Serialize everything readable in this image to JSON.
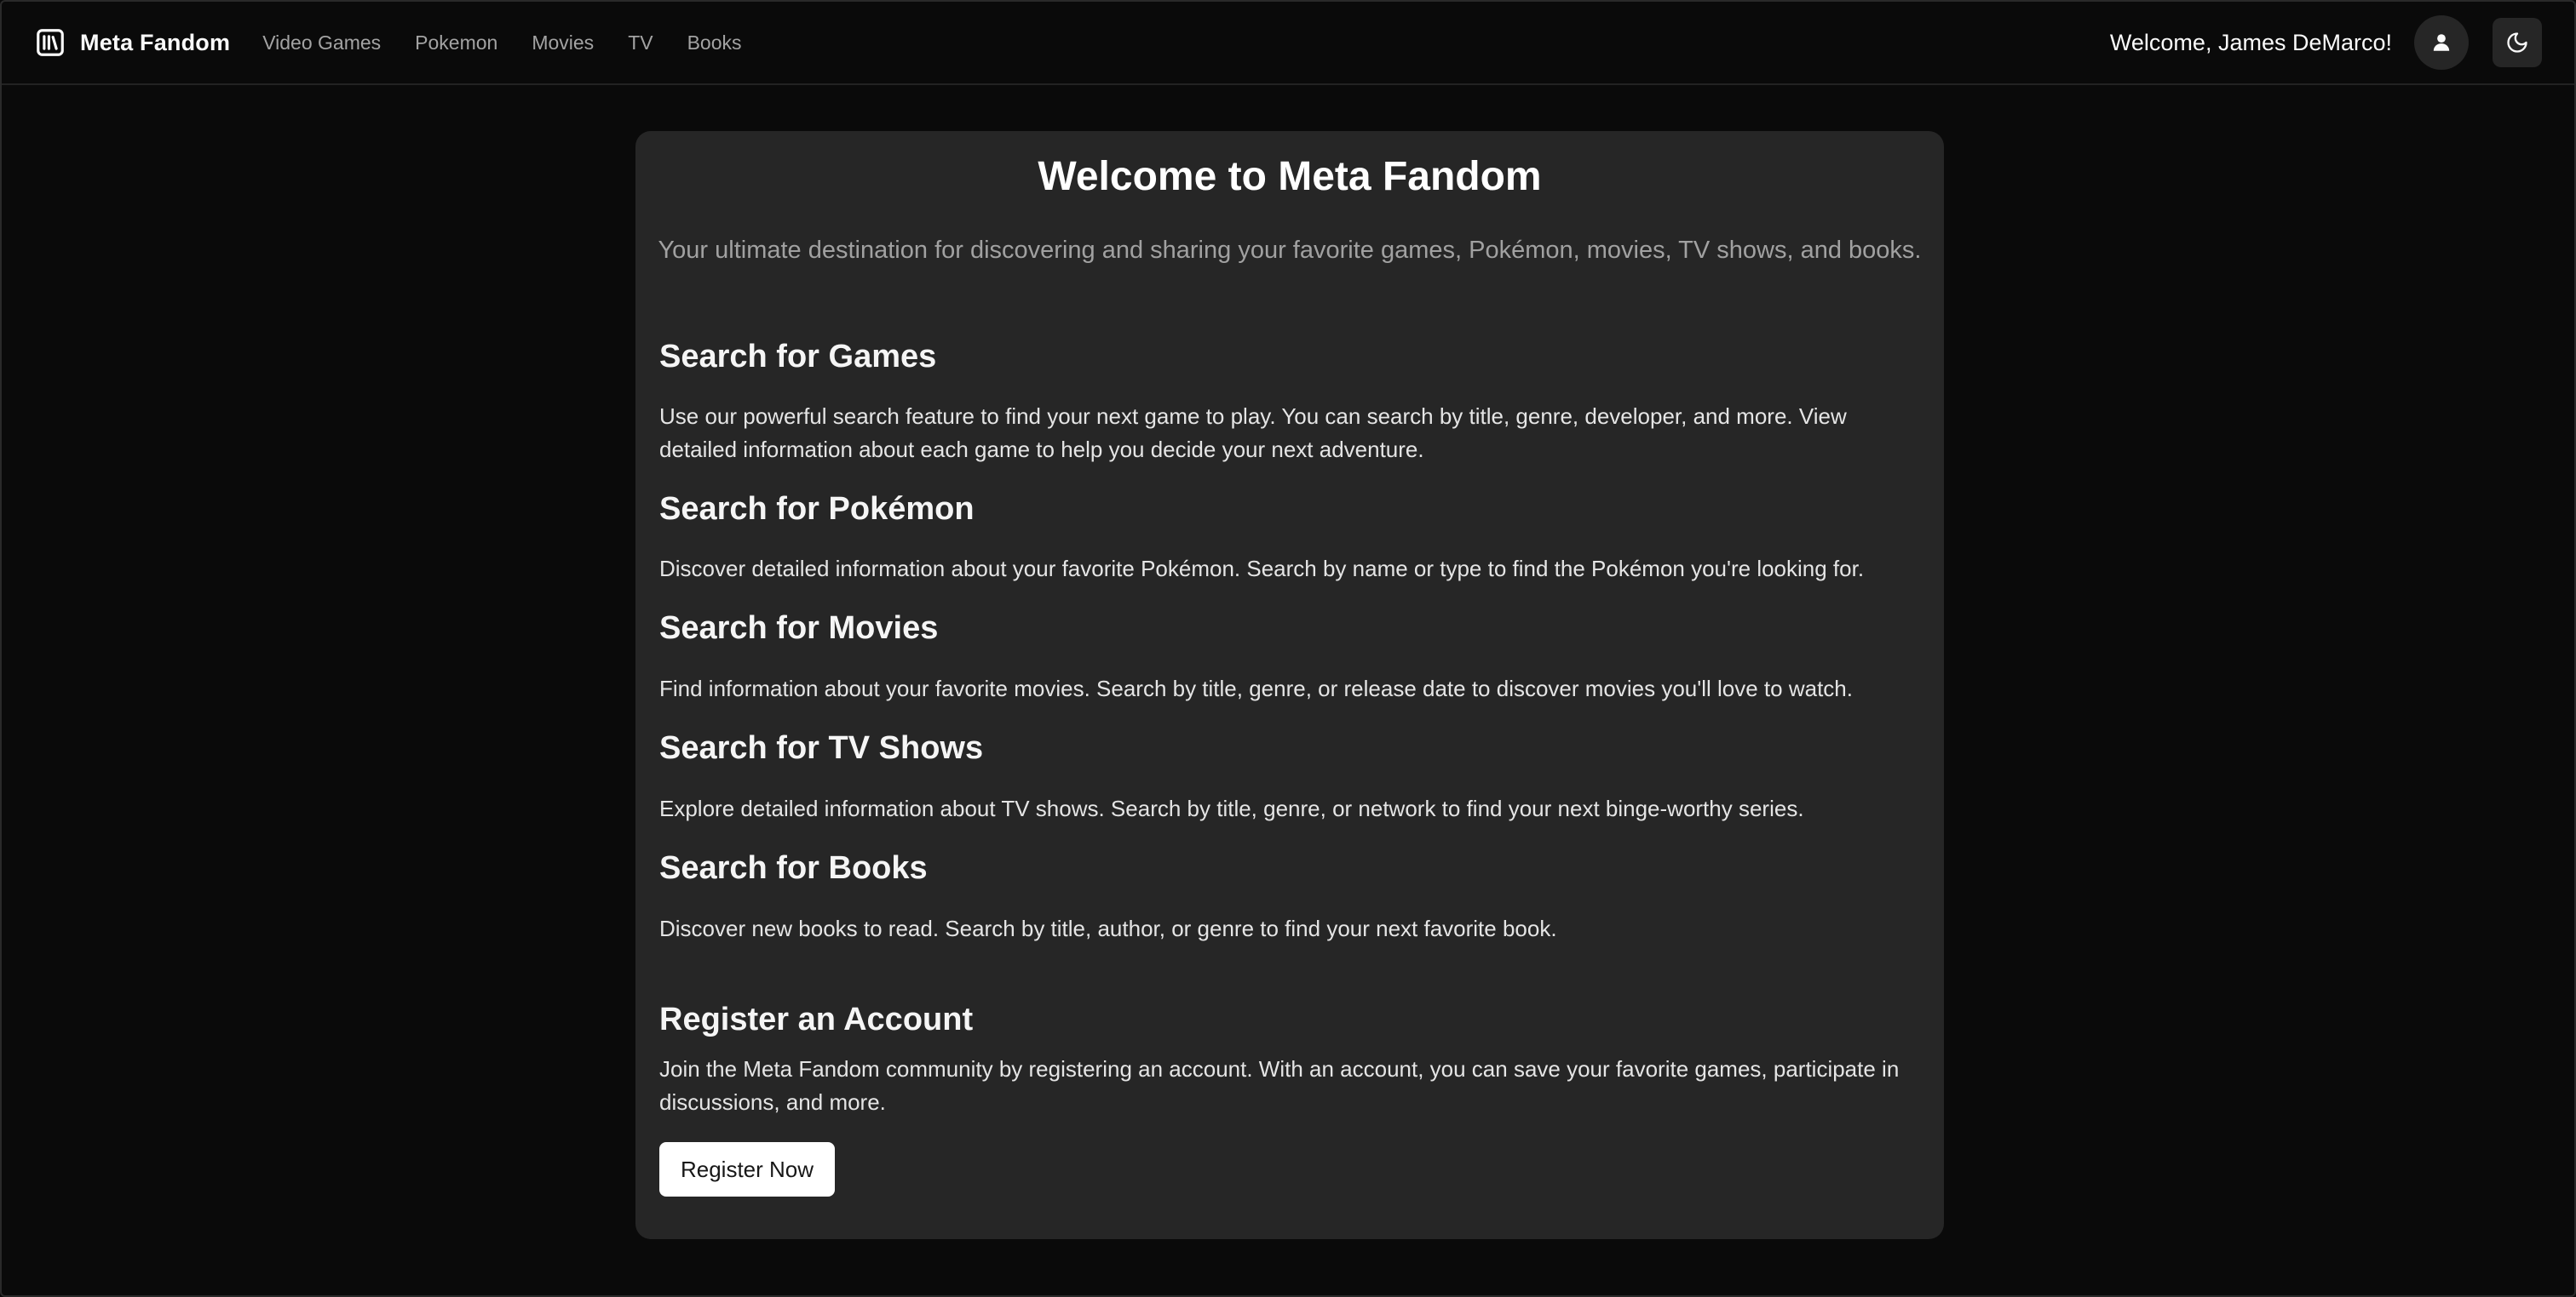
{
  "header": {
    "brand_name": "Meta Fandom",
    "brand_icon": "library-icon",
    "nav": [
      {
        "label": "Video Games"
      },
      {
        "label": "Pokemon"
      },
      {
        "label": "Movies"
      },
      {
        "label": "TV"
      },
      {
        "label": "Books"
      }
    ],
    "welcome_text": "Welcome, James DeMarco!",
    "avatar_icon": "user-icon",
    "theme_icon": "moon-icon"
  },
  "main": {
    "title": "Welcome to Meta Fandom",
    "subtitle": "Your ultimate destination for discovering and sharing your favorite games, Pokémon, movies, TV shows, and books.",
    "sections": [
      {
        "title": "Search for Games",
        "text": "Use our powerful search feature to find your next game to play. You can search by title, genre, developer, and more. View detailed information about each game to help you decide your next adventure."
      },
      {
        "title": "Search for Pokémon",
        "text": "Discover detailed information about your favorite Pokémon. Search by name or type to find the Pokémon you're looking for."
      },
      {
        "title": "Search for Movies",
        "text": "Find information about your favorite movies. Search by title, genre, or release date to discover movies you'll love to watch."
      },
      {
        "title": "Search for TV Shows",
        "text": "Explore detailed information about TV shows. Search by title, genre, or network to find your next binge-worthy series."
      },
      {
        "title": "Search for Books",
        "text": "Discover new books to read. Search by title, author, or genre to find your next favorite book."
      }
    ],
    "register": {
      "title": "Register an Account",
      "text": "Join the Meta Fandom community by registering an account. With an account, you can save your favorite games, participate in discussions, and more.",
      "button_label": "Register Now"
    }
  },
  "colors": {
    "background": "#0a0a0a",
    "card": "#262626",
    "text": "#fafafa",
    "muted": "#a3a3a3",
    "button_bg": "#ffffff"
  }
}
